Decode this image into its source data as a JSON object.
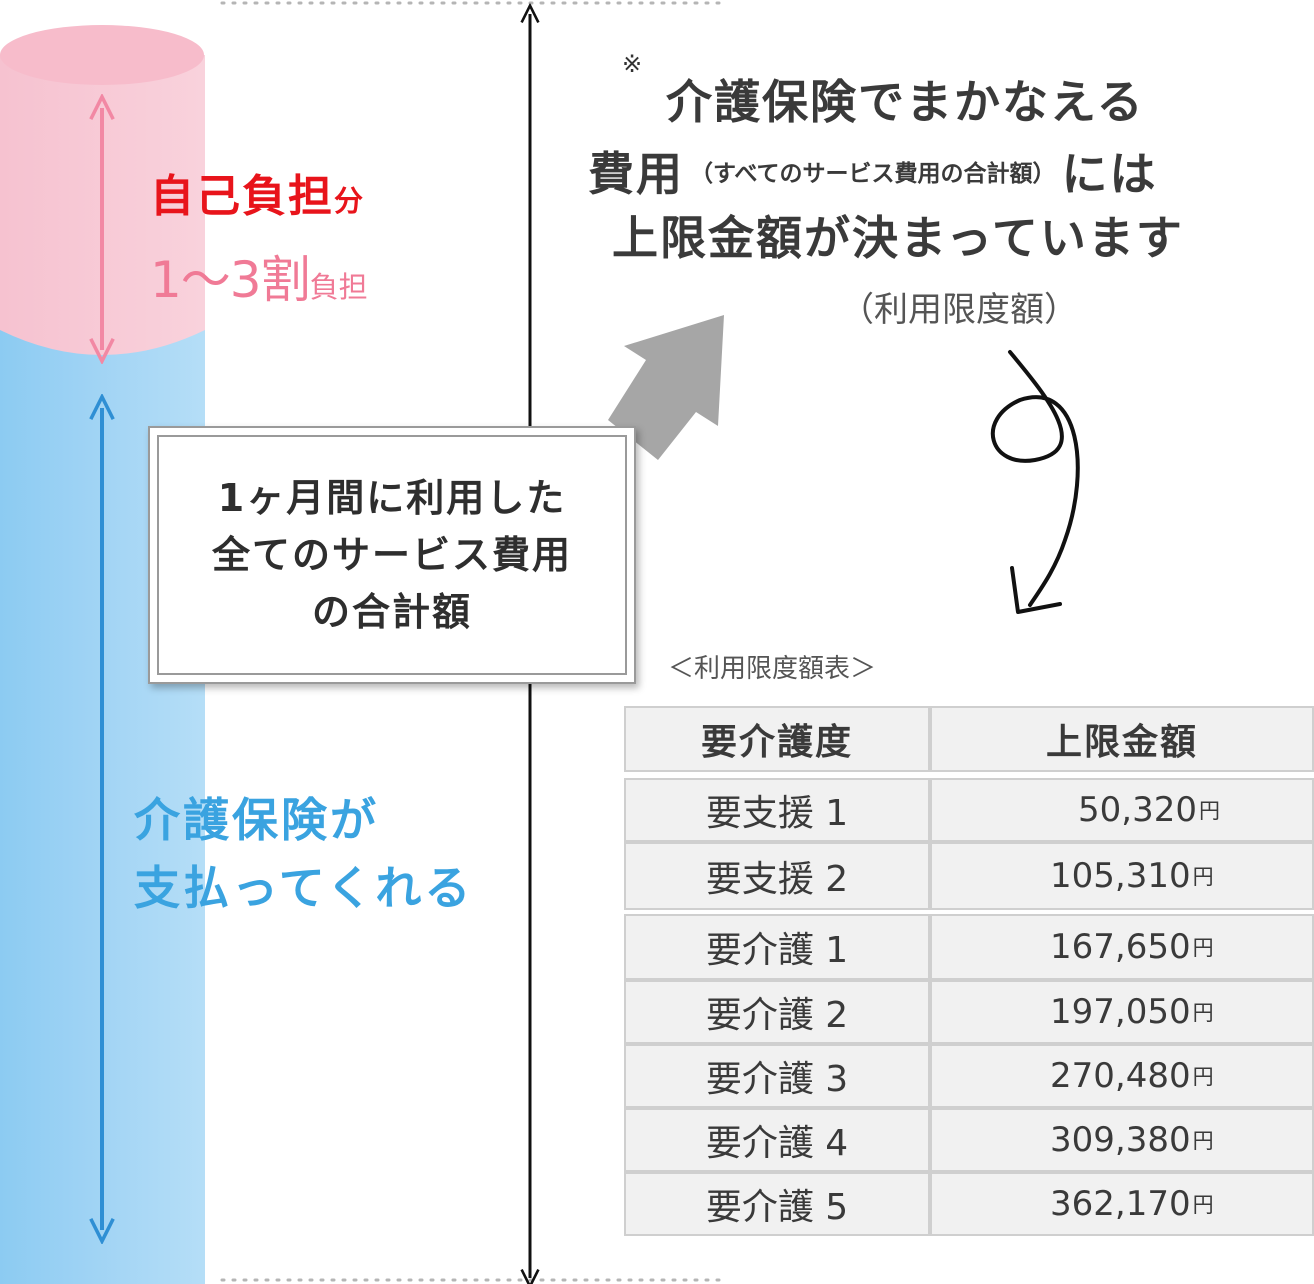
{
  "self_share": {
    "title": "自己負担",
    "title_suffix": "分",
    "ratio": "1〜3割",
    "ratio_suffix": "負担"
  },
  "insurance_pays": {
    "line1": "介護保険が",
    "line2": "支払ってくれる"
  },
  "total_box": {
    "line1": "1ヶ月間に利用した",
    "line2": "全てのサービス費用",
    "line3": "の合計額"
  },
  "heading": {
    "note_mark": "※",
    "line1": "介護保険でまかなえる",
    "line2_main": "費用",
    "line2_paren": "（すべてのサービス費用の合計額）",
    "line2_end": "には",
    "line3": "上限金額が決まっています",
    "line4": "（利用限度額）"
  },
  "table": {
    "caption": "＜利用限度額表＞",
    "headers": [
      "要介護度",
      "上限金額"
    ],
    "currency": "円",
    "rows": [
      {
        "level": "要支援 1",
        "amount": "50,320"
      },
      {
        "level": "要支援 2",
        "amount": "105,310"
      },
      {
        "level": "要介護 1",
        "amount": "167,650"
      },
      {
        "level": "要介護 2",
        "amount": "197,050"
      },
      {
        "level": "要介護 3",
        "amount": "270,480"
      },
      {
        "level": "要介護 4",
        "amount": "309,380"
      },
      {
        "level": "要介護 5",
        "amount": "362,170"
      }
    ]
  },
  "colors": {
    "pink_top": "#f7c6d3",
    "blue_body": "#9fd2f4",
    "self_title": "#e8141b",
    "self_ratio": "#f07a96",
    "insurance_text": "#3aa3e0",
    "arrow_gray": "#a6a6a6"
  }
}
